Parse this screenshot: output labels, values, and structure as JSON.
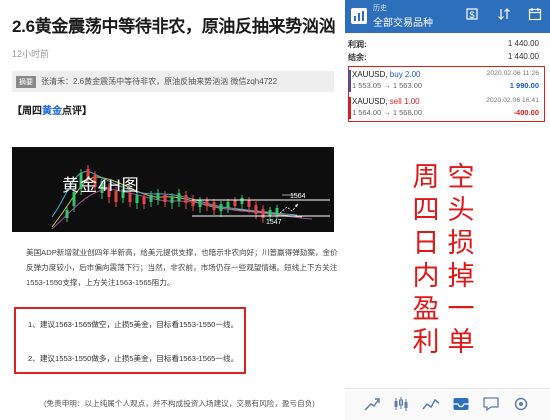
{
  "article": {
    "title": "2.6黄金震荡中等待非农，原油反抽来势汹汹",
    "time": "12小时前",
    "summary_badge": "摘要",
    "summary": "张清禾：2.6黄金震荡中等待非农，原油反抽来势汹汹 微信zqh4722",
    "section_prefix": "【周四",
    "section_highlight": "黄金",
    "section_suffix": "点评】",
    "chart_label": "黄金4H图",
    "chart_levels": {
      "upper": "1564",
      "lower": "1547"
    },
    "paragraph": "美国ADP新增就业创四年半新高，给美元提供支撑，也暗示非农向好；川普赢得弹劾案，金价反弹力度较小，后市偏向震荡下行；当然，非农前，市场仍存一些观望情绪。短线上下方关注1553-1550支撑，上方关注1563-1565阻力。",
    "advice": [
      "1、建议1563-1565做空，止损5美金，目标看1553-1550一线。",
      "2、建议1553-1550做多，止损5美金，目标看1563-1565一线。"
    ],
    "disclaimer": "(免责申明：以上纯属个人观点，并不构成投资入场建议，交易有风险，盈亏自负)"
  },
  "phone": {
    "status": "历史",
    "title": "全部交易品种",
    "summary_rows": [
      {
        "label": "利润:",
        "value": "1 440.00"
      },
      {
        "label": "结余:",
        "value": "1 440.00"
      }
    ],
    "positions": [
      {
        "symbol": "XAUUSD,",
        "side": "buy 2.00",
        "prices": "1 553.05 → 1 563.00",
        "date": "2020.02.06 11:26",
        "profit": "1 990.00"
      },
      {
        "symbol": "XAUUSD,",
        "side": "sell 1.00",
        "prices": "1 564.00 → 1 568.00",
        "date": "2020.02.06 16:41",
        "profit": "-400.00"
      }
    ],
    "overlay_col1": [
      "空",
      "头",
      "损",
      "掉",
      "一",
      "单"
    ],
    "overlay_col2": [
      "周",
      "四",
      "日",
      "内",
      "盈",
      "利"
    ]
  },
  "icons": {
    "app": "mt4-app-icon",
    "top": [
      "orders-icon",
      "sort-icon",
      "calendar-icon"
    ],
    "bottom": [
      "quotes-icon",
      "chart-icon",
      "trade-icon",
      "history-icon",
      "messages-icon",
      "settings-icon"
    ]
  },
  "colors": {
    "header": "#2d6fbb",
    "red": "#e02020",
    "buy_blue": "#1b5cc5"
  }
}
